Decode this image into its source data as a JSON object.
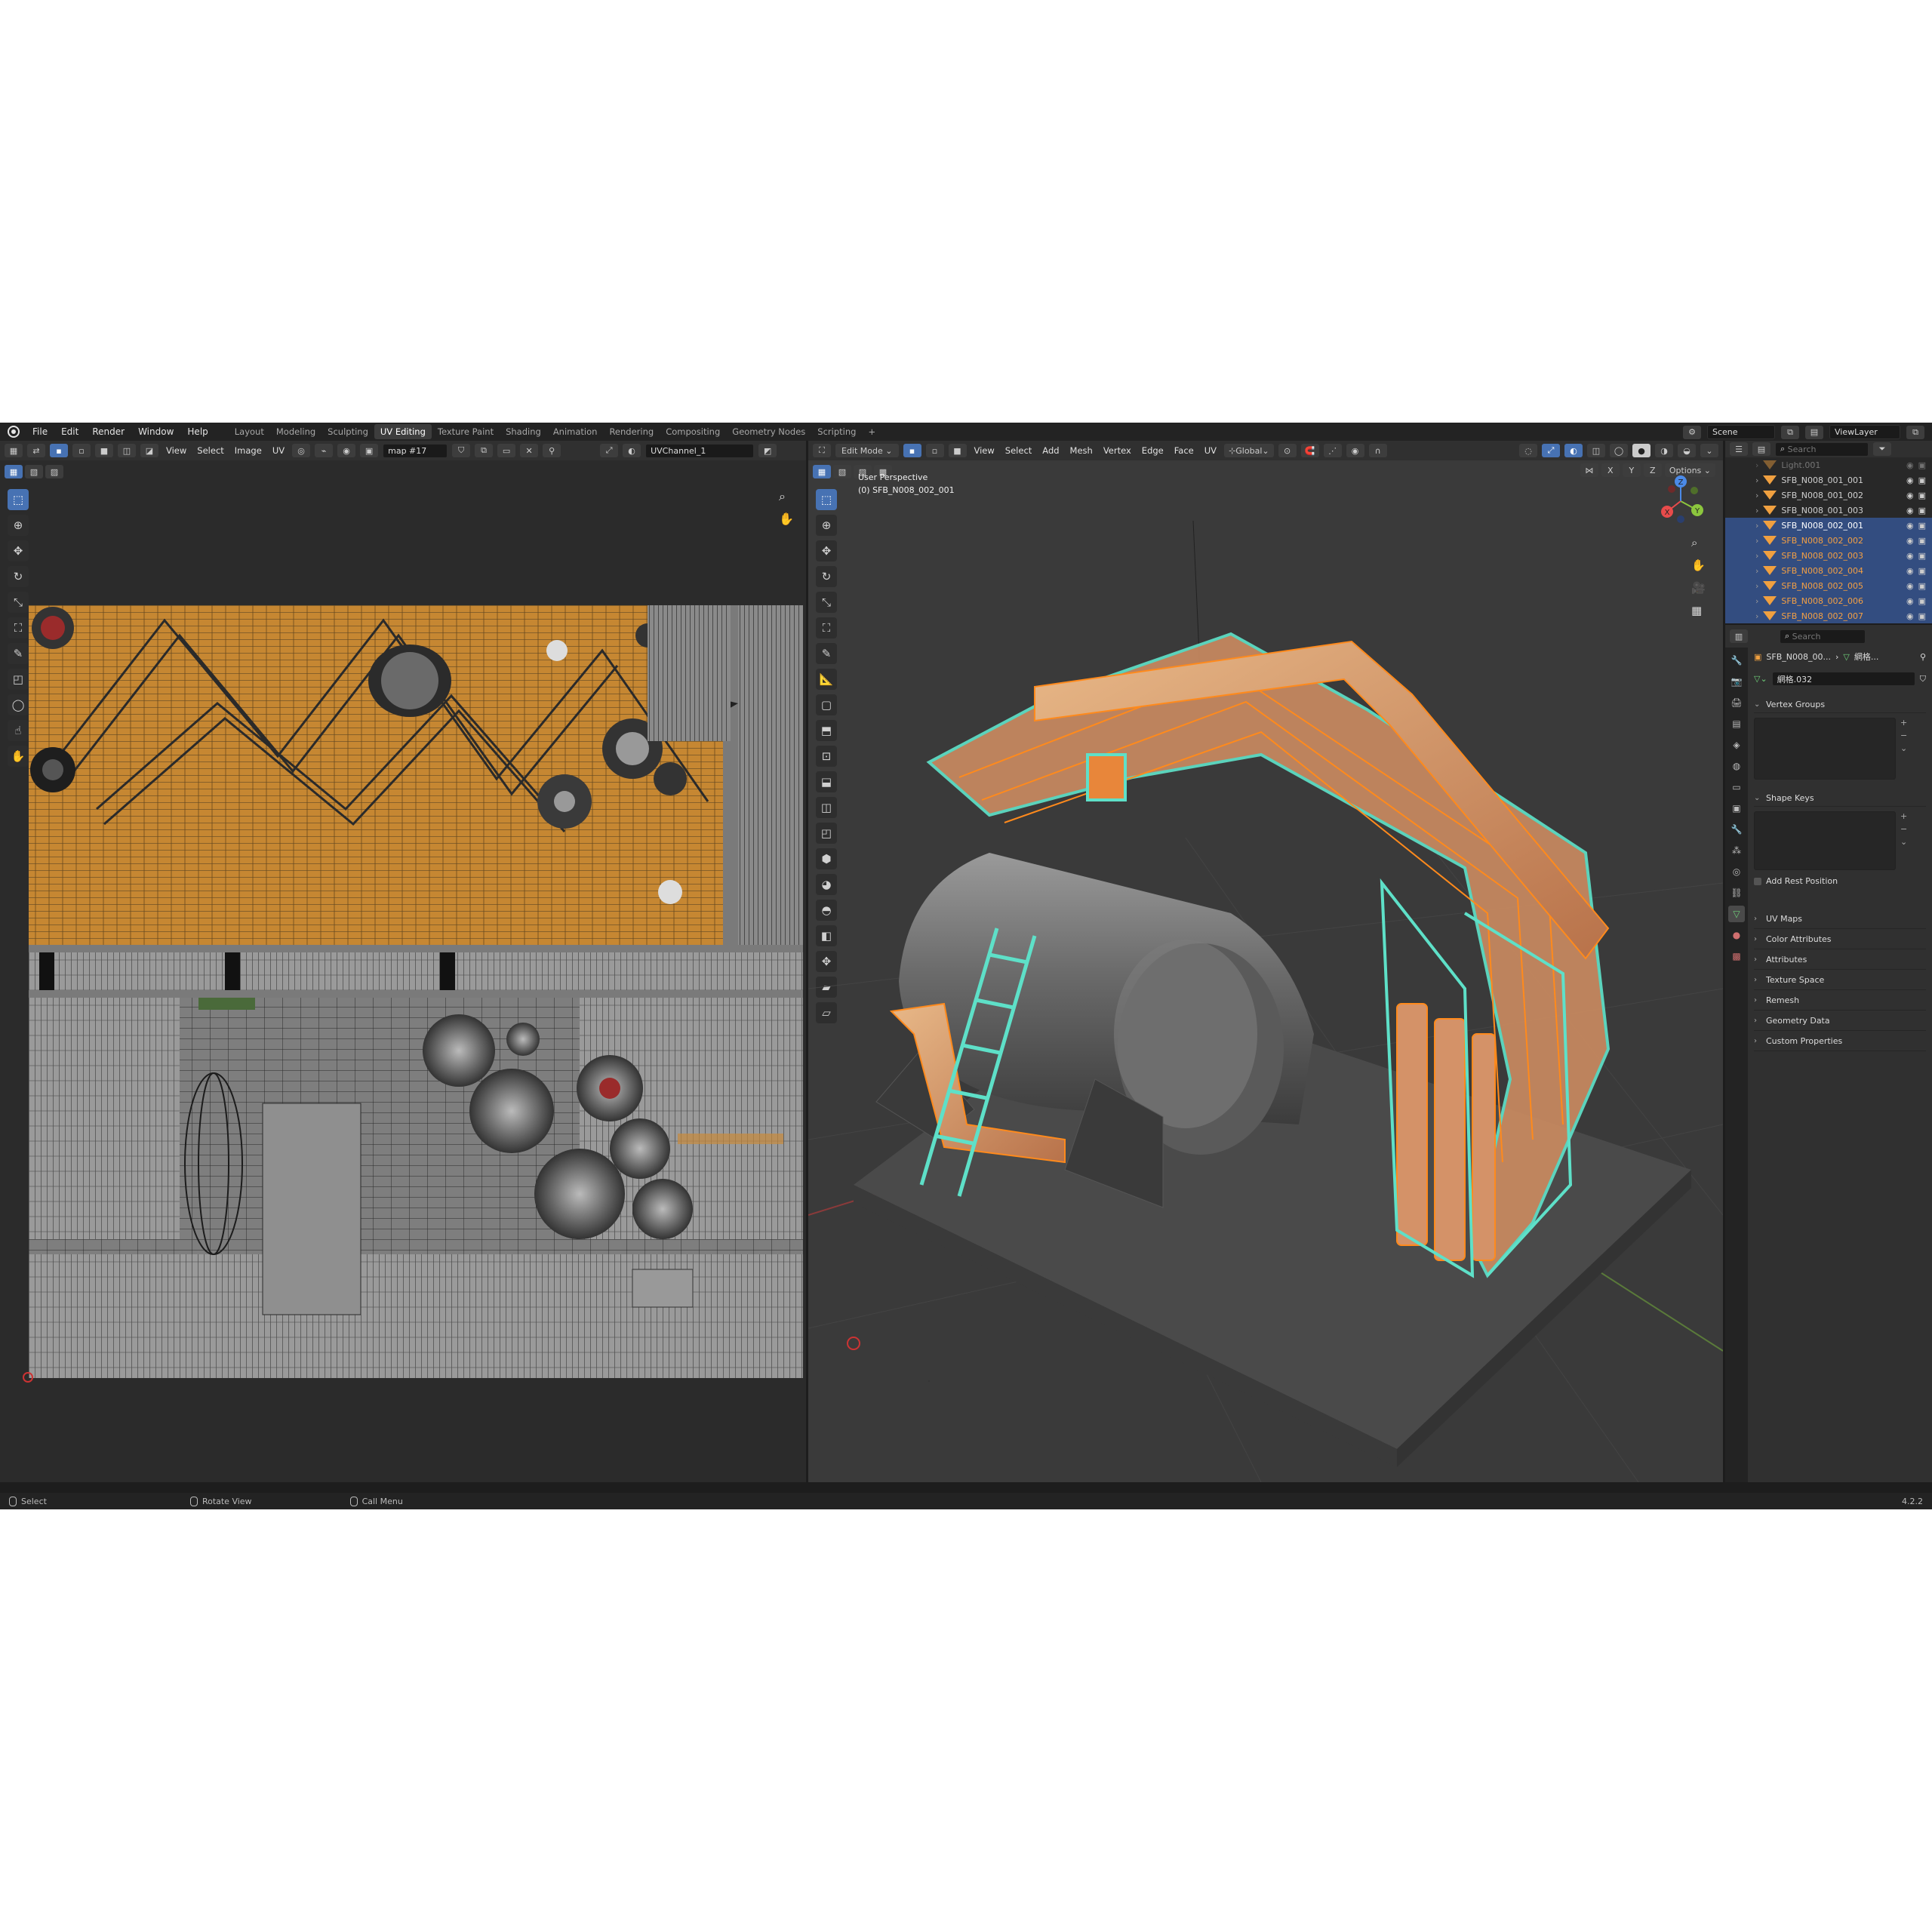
{
  "menu": [
    "File",
    "Edit",
    "Render",
    "Window",
    "Help"
  ],
  "workspaces": [
    "Layout",
    "Modeling",
    "Sculpting",
    "UV Editing",
    "Texture Paint",
    "Shading",
    "Animation",
    "Rendering",
    "Compositing",
    "Geometry Nodes",
    "Scripting"
  ],
  "active_workspace": "UV Editing",
  "topright": {
    "scene": "Scene",
    "viewlayer": "ViewLayer"
  },
  "uv_editor": {
    "header_menus": [
      "View",
      "Select",
      "Image",
      "UV"
    ],
    "image_name": "map #17",
    "uv_channel": "UVChannel_1"
  },
  "viewport": {
    "mode": "Edit Mode",
    "header_menus": [
      "View",
      "Select",
      "Add",
      "Mesh",
      "Vertex",
      "Edge",
      "Face",
      "UV"
    ],
    "orientation": "Global",
    "options_label": "Options",
    "axis_toggles": [
      "X",
      "Y",
      "Z"
    ],
    "overlay_title": "User Perspective",
    "overlay_object": "(0) SFB_N008_002_001",
    "gizmo": {
      "x": "X",
      "y": "Y",
      "z": "Z"
    }
  },
  "outliner": {
    "search_placeholder": "Search",
    "rows": [
      {
        "name": "Light.001",
        "state": "dim"
      },
      {
        "name": "SFB_N008_001_001",
        "state": "normal"
      },
      {
        "name": "SFB_N008_001_002",
        "state": "normal"
      },
      {
        "name": "SFB_N008_001_003",
        "state": "normal"
      },
      {
        "name": "SFB_N008_002_001",
        "state": "active"
      },
      {
        "name": "SFB_N008_002_002",
        "state": "selected"
      },
      {
        "name": "SFB_N008_002_003",
        "state": "selected"
      },
      {
        "name": "SFB_N008_002_004",
        "state": "selected"
      },
      {
        "name": "SFB_N008_002_005",
        "state": "selected"
      },
      {
        "name": "SFB_N008_002_006",
        "state": "selected"
      },
      {
        "name": "SFB_N008_002_007",
        "state": "selected"
      }
    ]
  },
  "properties": {
    "search_placeholder": "Search",
    "breadcrumb_object": "SFB_N008_00...",
    "breadcrumb_mesh": "網格...",
    "mesh_name": "網格.032",
    "panels": [
      "Vertex Groups",
      "Shape Keys",
      "UV Maps",
      "Color Attributes",
      "Attributes",
      "Texture Space",
      "Remesh",
      "Geometry Data",
      "Custom Properties"
    ],
    "add_rest_position": "Add Rest Position"
  },
  "status": {
    "select": "Select",
    "rotate": "Rotate View",
    "menu": "Call Menu",
    "version": "4.2.2"
  },
  "colors": {
    "accent": "#4772b3",
    "selected_orange": "#f5a043",
    "wire_cyan": "#5ee0c8",
    "edit_orange": "#ff8a1c"
  }
}
